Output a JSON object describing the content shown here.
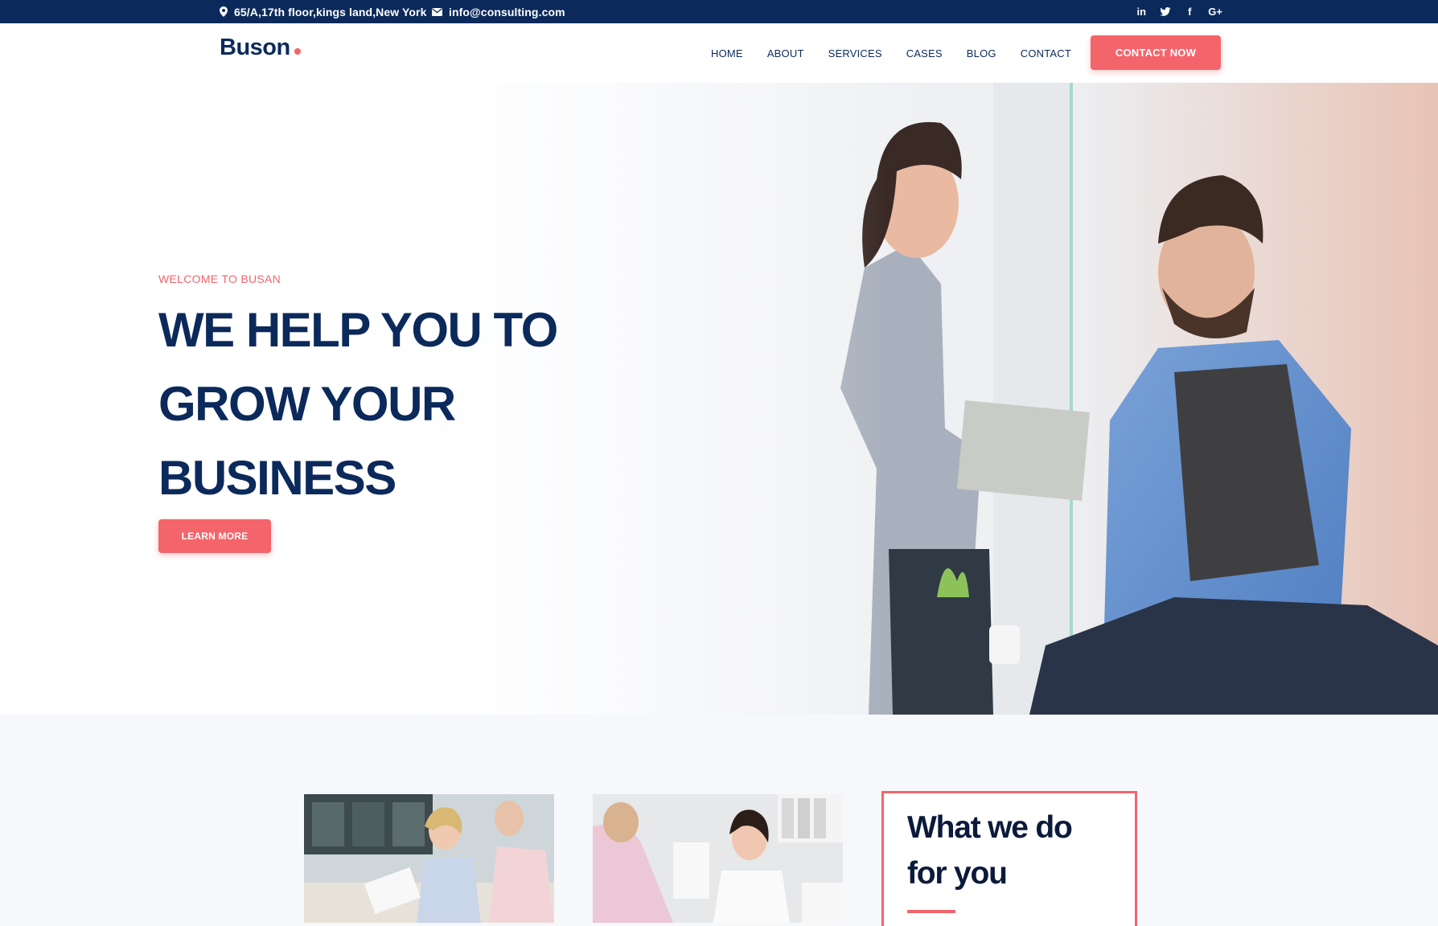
{
  "topbar": {
    "address": "65/A,17th floor,kings land,New York",
    "email": "info@consulting.com",
    "socials": [
      {
        "name": "linkedin-icon",
        "label": "in"
      },
      {
        "name": "twitter-icon",
        "label": ""
      },
      {
        "name": "facebook-icon",
        "label": "f"
      },
      {
        "name": "google-plus-icon",
        "label": "G+"
      }
    ]
  },
  "header": {
    "logo": "Buson",
    "nav": [
      "HOME",
      "ABOUT",
      "SERVICES",
      "CASES",
      "BLOG",
      "CONTACT"
    ],
    "cta": "CONTACT NOW"
  },
  "hero": {
    "kicker": "WELCOME TO BUSAN",
    "title_lines": [
      "WE HELP YOU TO",
      "GROW YOUR",
      "BUSINESS"
    ],
    "button": "LEARN MORE"
  },
  "services": {
    "heading_lines": [
      "What we do",
      "for you"
    ]
  },
  "colors": {
    "navy": "#0b2a5b",
    "accent": "#f4646b",
    "background": "#f7f8fc"
  }
}
